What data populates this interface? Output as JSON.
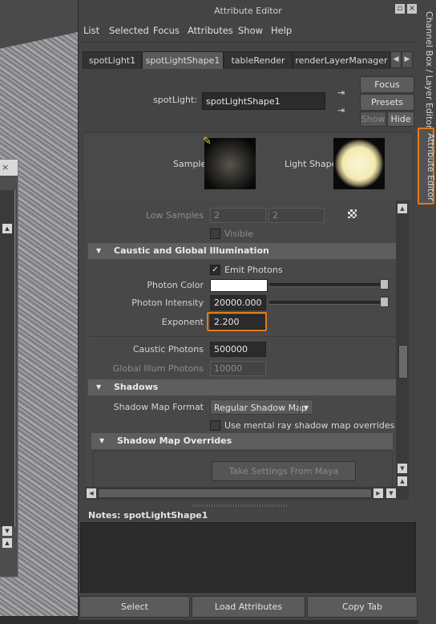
{
  "window": {
    "title": "Attribute Editor"
  },
  "menu": [
    "List",
    "Selected",
    "Focus",
    "Attributes",
    "Show",
    "Help"
  ],
  "tabs": [
    {
      "label": "spotLight1",
      "active": false
    },
    {
      "label": "spotLightShape1",
      "active": true
    },
    {
      "label": "tableRender",
      "active": false
    },
    {
      "label": "renderLayerManager",
      "active": false
    }
  ],
  "header": {
    "node_type_label": "spotLight:",
    "node_name_value": "spotLightShape1",
    "focus_label": "Focus",
    "presets_label": "Presets",
    "show_label": "Show",
    "hide_label": "Hide"
  },
  "swatches": {
    "sample_label": "Sample",
    "light_shape_label": "Light Shape"
  },
  "low_samples": {
    "label": "Low Samples",
    "value1": "2",
    "value2": "2",
    "visible_label": "Visible"
  },
  "caustic": {
    "title": "Caustic and Global Illumination",
    "emit_photons_label": "Emit Photons",
    "emit_photons_checked": true,
    "photon_color_label": "Photon Color",
    "photon_color": "#ffffff",
    "photon_intensity_label": "Photon Intensity",
    "photon_intensity_value": "20000.000",
    "exponent_label": "Exponent",
    "exponent_value": "2.200",
    "caustic_photons_label": "Caustic Photons",
    "caustic_photons_value": "500000",
    "global_illum_label": "Global Illum Photons",
    "global_illum_value": "10000"
  },
  "shadows": {
    "title": "Shadows",
    "map_format_label": "Shadow Map Format",
    "map_format_value": "Regular Shadow Map",
    "mental_ray_override_label": "Use mental ray shadow map overrides"
  },
  "shadow_overrides": {
    "title": "Shadow Map Overrides",
    "take_settings_label": "Take Settings From Maya"
  },
  "notes": {
    "label": "Notes:",
    "node": "spotLightShape1"
  },
  "bottom_buttons": {
    "select": "Select",
    "load_attributes": "Load Attributes",
    "copy_tab": "Copy Tab"
  },
  "side_tabs": {
    "channel_box": "Channel Box / Layer Editor",
    "attribute_editor": "Attribute Editor"
  },
  "colors": {
    "highlight": "#e07c18",
    "background": "#444444",
    "field": "#2b2b2b"
  }
}
